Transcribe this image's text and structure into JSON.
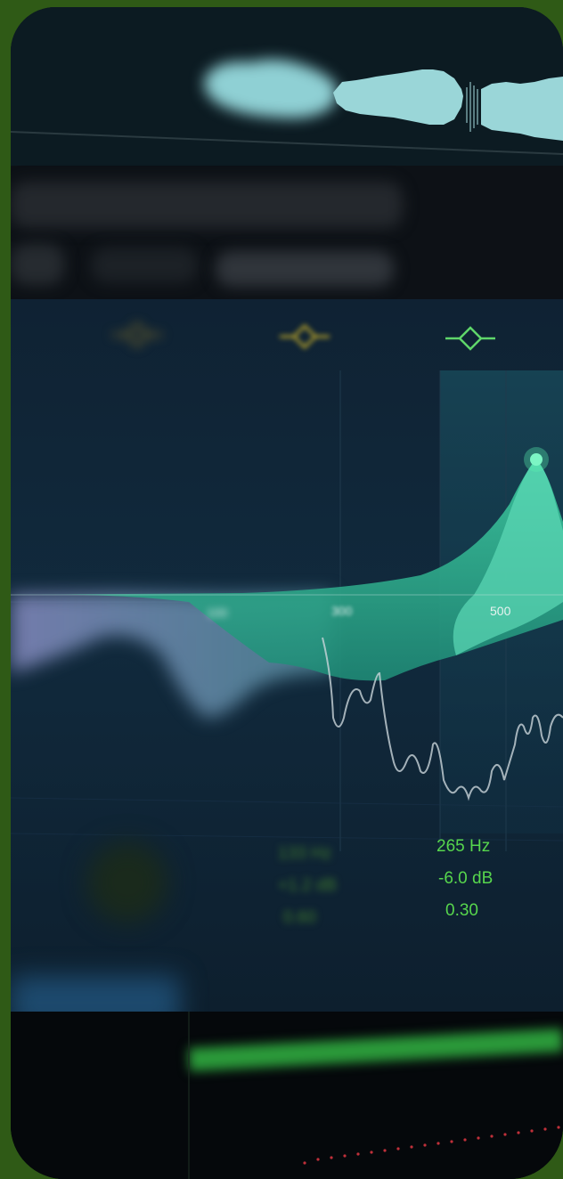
{
  "eq": {
    "freq_labels": [
      "100",
      "300",
      "500"
    ],
    "selected_band": {
      "frequency": "265 Hz",
      "gain": "-6.0 dB",
      "q": "0.30"
    },
    "inactive_band": {
      "frequency": "133 Hz",
      "gain": "+1.2 dB",
      "q": "0.60"
    },
    "band_icons": [
      "bell-band-icon",
      "bell-band-icon",
      "bell-band-icon"
    ]
  },
  "colors": {
    "accent_green": "#57d64d",
    "curve_teal": "#2fb58f",
    "node_glow": "#5af0b0",
    "band_yellow": "#b9a42a"
  }
}
